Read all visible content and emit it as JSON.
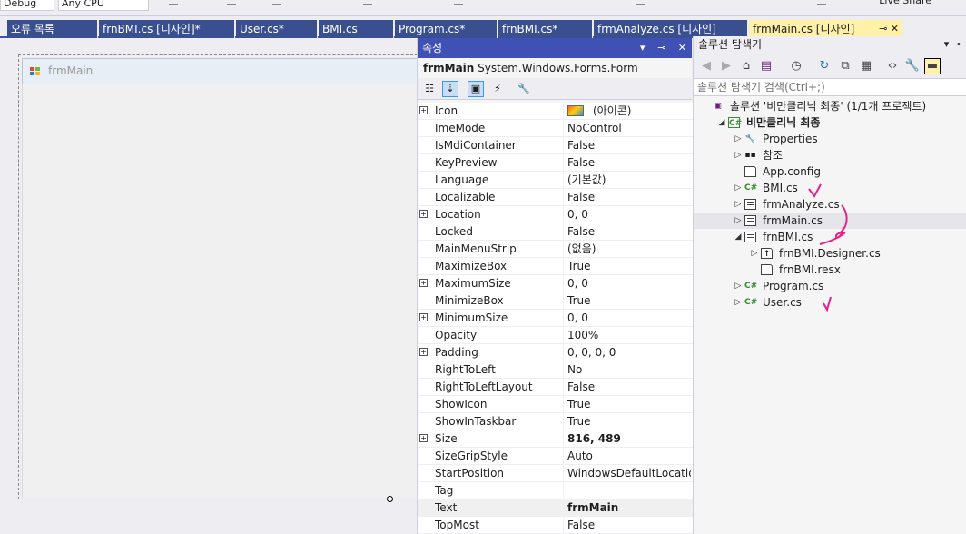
{
  "toolbar": {
    "configuration": "Debug",
    "platform": "Any CPU",
    "live_share": "Live Share"
  },
  "doc_tabs": [
    {
      "label": "오류 목록"
    },
    {
      "label": "frnBMI.cs [디자인]*"
    },
    {
      "label": "User.cs*"
    },
    {
      "label": "BMI.cs"
    },
    {
      "label": "Program.cs*"
    },
    {
      "label": "frnBMI.cs*"
    },
    {
      "label": "frmAnalyze.cs [디자인]"
    },
    {
      "label": "frmMain.cs [디자인]"
    }
  ],
  "designer": {
    "form_title": "frmMain"
  },
  "properties": {
    "title": "속성",
    "object_name": "frmMain",
    "object_type": "System.Windows.Forms.Form",
    "rows": [
      {
        "name": "Icon",
        "value": "(아이콘)",
        "expandable": true,
        "swatch": true
      },
      {
        "name": "ImeMode",
        "value": "NoControl"
      },
      {
        "name": "IsMdiContainer",
        "value": "False"
      },
      {
        "name": "KeyPreview",
        "value": "False"
      },
      {
        "name": "Language",
        "value": "(기본값)"
      },
      {
        "name": "Localizable",
        "value": "False"
      },
      {
        "name": "Location",
        "value": "0, 0",
        "expandable": true
      },
      {
        "name": "Locked",
        "value": "False"
      },
      {
        "name": "MainMenuStrip",
        "value": "(없음)"
      },
      {
        "name": "MaximizeBox",
        "value": "True"
      },
      {
        "name": "MaximumSize",
        "value": "0, 0",
        "expandable": true
      },
      {
        "name": "MinimizeBox",
        "value": "True"
      },
      {
        "name": "MinimumSize",
        "value": "0, 0",
        "expandable": true
      },
      {
        "name": "Opacity",
        "value": "100%"
      },
      {
        "name": "Padding",
        "value": "0, 0, 0, 0",
        "expandable": true
      },
      {
        "name": "RightToLeft",
        "value": "No"
      },
      {
        "name": "RightToLeftLayout",
        "value": "False"
      },
      {
        "name": "ShowIcon",
        "value": "True"
      },
      {
        "name": "ShowInTaskbar",
        "value": "True"
      },
      {
        "name": "Size",
        "value": "816, 489",
        "expandable": true,
        "bold": true
      },
      {
        "name": "SizeGripStyle",
        "value": "Auto"
      },
      {
        "name": "StartPosition",
        "value": "WindowsDefaultLocation"
      },
      {
        "name": "Tag",
        "value": ""
      },
      {
        "name": "Text",
        "value": "frmMain",
        "bold": true,
        "selected": true
      },
      {
        "name": "TopMost",
        "value": "False"
      }
    ]
  },
  "solution_explorer": {
    "title": "솔루션 탐색기",
    "search_placeholder": "솔루션 탐색기 검색(Ctrl+;)",
    "tree": [
      {
        "label": "솔루션 '비만클리닉 최종' (1/1개 프로젝트)",
        "icon": "solution-icon",
        "level": 0,
        "arrow": ""
      },
      {
        "label": "비만클리닉 최종",
        "icon": "csharp-project-icon",
        "level": 1,
        "arrow": "expanded",
        "bold": true
      },
      {
        "label": "Properties",
        "icon": "wrench-icon",
        "level": 2,
        "arrow": "collapsed"
      },
      {
        "label": "참조",
        "icon": "references-icon",
        "level": 2,
        "arrow": "collapsed"
      },
      {
        "label": "App.config",
        "icon": "config-file-icon",
        "level": 2,
        "arrow": ""
      },
      {
        "label": "BMI.cs",
        "icon": "csharp-file-icon",
        "level": 2,
        "arrow": "collapsed"
      },
      {
        "label": "frmAnalyze.cs",
        "icon": "form-icon",
        "level": 2,
        "arrow": "collapsed"
      },
      {
        "label": "frmMain.cs",
        "icon": "form-icon",
        "level": 2,
        "arrow": "collapsed",
        "highlight": true
      },
      {
        "label": "frnBMI.cs",
        "icon": "form-icon",
        "level": 2,
        "arrow": "expanded"
      },
      {
        "label": "frnBMI.Designer.cs",
        "icon": "designer-file-icon",
        "level": 3,
        "arrow": "collapsed"
      },
      {
        "label": "frnBMI.resx",
        "icon": "resx-file-icon",
        "level": 3,
        "arrow": ""
      },
      {
        "label": "Program.cs",
        "icon": "csharp-file-icon",
        "level": 2,
        "arrow": "collapsed"
      },
      {
        "label": "User.cs",
        "icon": "csharp-file-icon",
        "level": 2,
        "arrow": "collapsed"
      }
    ]
  },
  "colors": {
    "accent": "#3f51b5",
    "tab_inactive": "#3a4f8f",
    "tab_active": "#fff1a8",
    "annotation": "#e8208a"
  }
}
